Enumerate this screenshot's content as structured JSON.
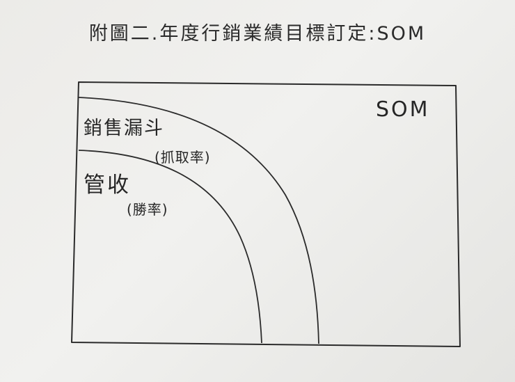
{
  "title": "附圖二.年度行銷業績目標訂定:SOM",
  "diagram": {
    "outer_label": "SOM",
    "middle_label": "銷售漏斗",
    "middle_sublabel": "(抓取率)",
    "inner_label": "管收",
    "inner_sublabel": "(勝率)"
  },
  "colors": {
    "paper": "#eeeeec",
    "ink": "#2a2a2a"
  }
}
